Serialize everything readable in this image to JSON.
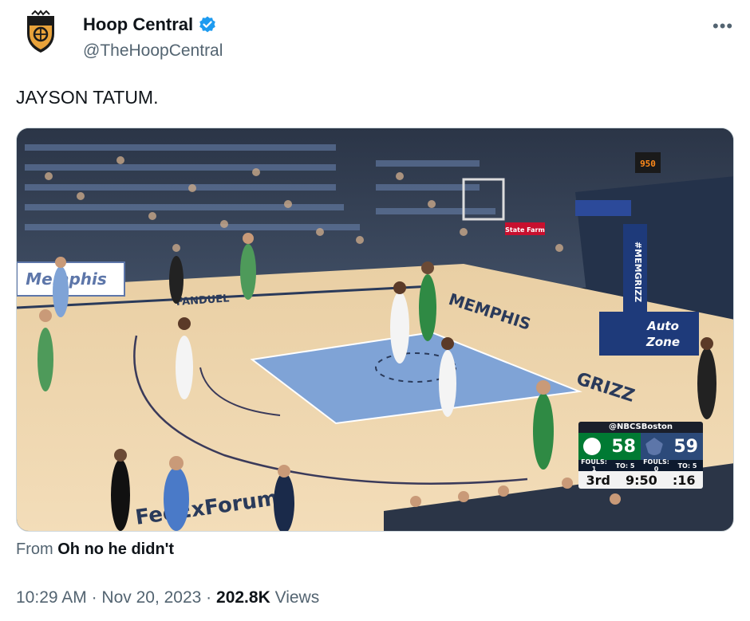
{
  "author": {
    "display_name": "Hoop Central",
    "handle": "@TheHoopCentral",
    "verified_icon": "verified-badge-icon",
    "avatar_icon": "hoop-central-shield-logo"
  },
  "more_icon": "more-dots-icon",
  "more_glyph": "•••",
  "tweet": {
    "text": "JAYSON TATUM."
  },
  "media": {
    "court_text": {
      "memphis": "MEMPHIS",
      "grizz": "GRIZZ",
      "memgrizz": "#MEMGRIZZ",
      "memphis_banner": "Memphis",
      "fanduel": "FANDUEL",
      "autozone_line1": "Auto",
      "autozone_line2": "Zone",
      "statefarm": "State Farm",
      "fedexforum": "FedExForum",
      "shot_clock": "950"
    },
    "scoreboard": {
      "network": "@NBCSBoston",
      "home_score": "58",
      "away_score": "59",
      "home_fouls": "FOULS: 1",
      "home_to": "TO: 5",
      "away_fouls": "FOULS: 0",
      "away_to": "TO: 5",
      "quarter": "3rd",
      "clock": "9:50",
      "shot_clock": ":16",
      "colors": {
        "home": "#007a33",
        "away": "#2c4a7a"
      }
    }
  },
  "source": {
    "prefix": "From",
    "name": "Oh no he didn't"
  },
  "meta": {
    "time": "10:29 AM",
    "sep1": " · ",
    "date": "Nov 20, 2023",
    "sep2": " · ",
    "views_count": "202.8K",
    "views_label": "Views"
  },
  "colors": {
    "verified_blue": "#1d9bf0",
    "secondary_text": "#536471",
    "primary_text": "#0f1419"
  }
}
